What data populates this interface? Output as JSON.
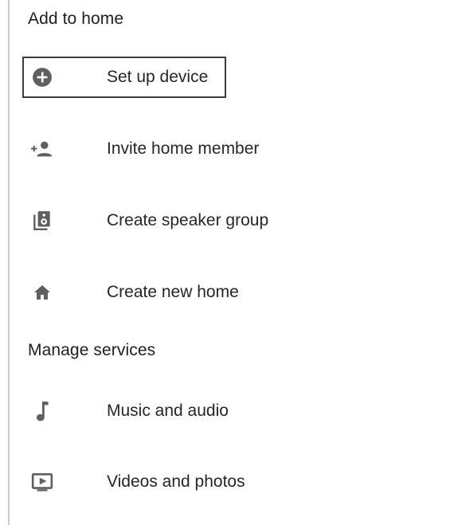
{
  "sections": [
    {
      "heading": "Add to home",
      "items": [
        {
          "label": "Set up device",
          "icon": "add-circle-icon"
        },
        {
          "label": "Invite home member",
          "icon": "person-add-icon"
        },
        {
          "label": "Create speaker group",
          "icon": "speaker-group-icon"
        },
        {
          "label": "Create new home",
          "icon": "home-icon"
        }
      ]
    },
    {
      "heading": "Manage services",
      "items": [
        {
          "label": "Music and audio",
          "icon": "music-note-icon"
        },
        {
          "label": "Videos and photos",
          "icon": "video-play-icon"
        }
      ]
    }
  ],
  "colors": {
    "icon": "#5f5f5f",
    "text": "#262626",
    "focus_border": "#3c3c3c"
  }
}
